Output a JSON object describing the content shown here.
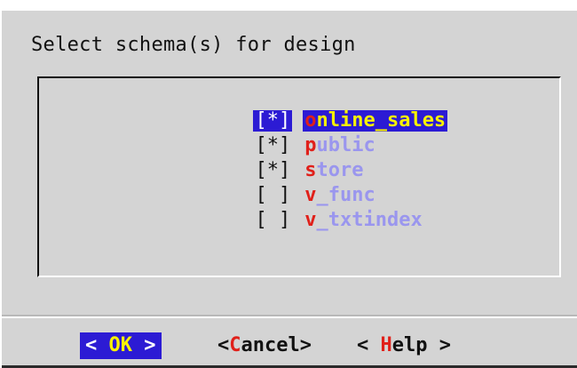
{
  "dialog": {
    "title": "Select schema(s) for design"
  },
  "schemas": [
    {
      "checkbox": "[*]",
      "hotkey": "o",
      "rest": "nline_sales",
      "selected": true
    },
    {
      "checkbox": "[*]",
      "hotkey": "p",
      "rest": "ublic",
      "selected": false
    },
    {
      "checkbox": "[*]",
      "hotkey": "s",
      "rest": "tore",
      "selected": false
    },
    {
      "checkbox": "[ ]",
      "hotkey": "v",
      "rest": "_func",
      "selected": false
    },
    {
      "checkbox": "[ ]",
      "hotkey": "v",
      "rest": "_txtindex",
      "selected": false
    }
  ],
  "buttons": {
    "ok": {
      "left": "< ",
      "hotkey": "OK",
      "right": " >"
    },
    "cancel": {
      "left": "<",
      "hotkey": "C",
      "rest": "ancel>"
    },
    "help": {
      "left": "< ",
      "hotkey": "H",
      "rest": "elp >"
    }
  },
  "colors": {
    "dialog_bg": "#d4d4d4",
    "selection_bg": "#2c1bd4",
    "selected_text": "#f8f200",
    "hotkey": "#e0201a",
    "item_text": "#9a96ee"
  }
}
